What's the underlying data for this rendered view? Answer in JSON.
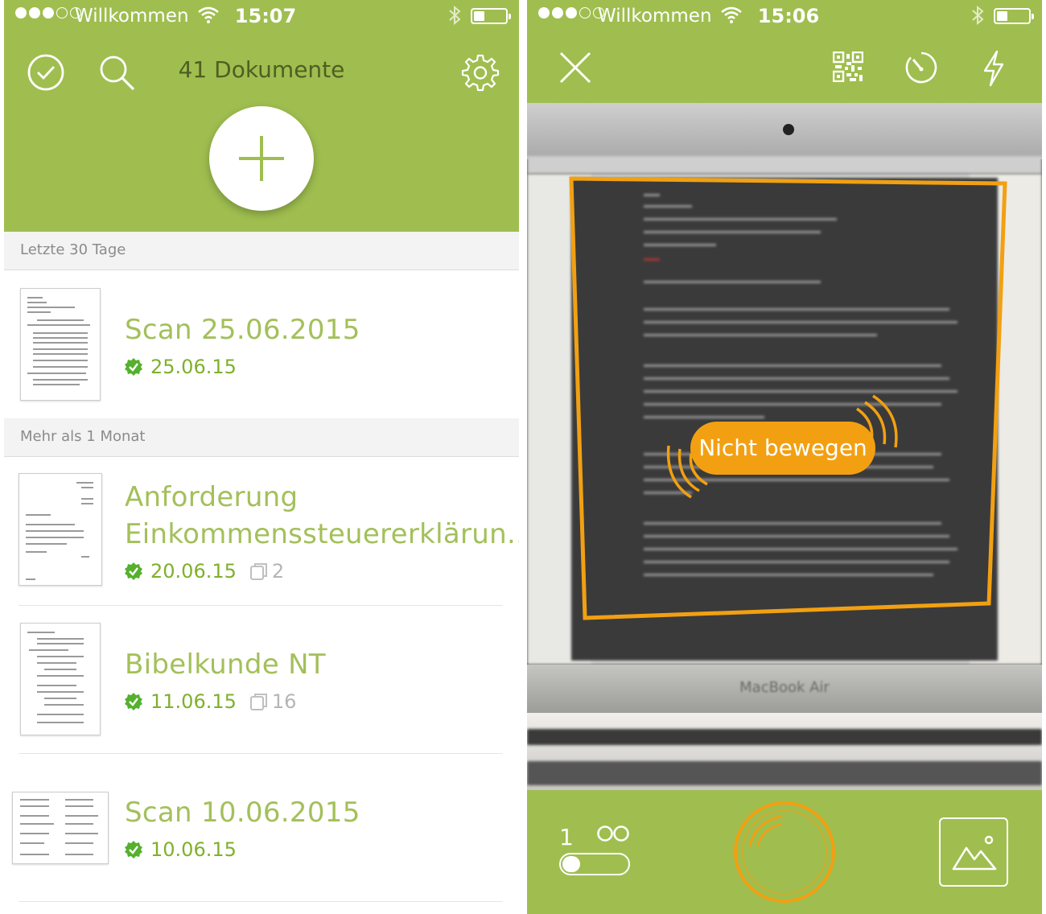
{
  "left": {
    "status": {
      "carrier": "Willkommen",
      "time": "15:07"
    },
    "header": {
      "title": "41 Dokumente"
    },
    "sections": [
      {
        "label": "Letzte 30 Tage"
      },
      {
        "label": "Mehr als 1 Monat"
      }
    ],
    "documents": [
      {
        "title": "Scan 25.06.2015",
        "date": "25.06.15",
        "pages": ""
      },
      {
        "title_line1": "Anforderung",
        "title_line2": "Einkommenssteuererklärun...",
        "date": "20.06.15",
        "pages": "2"
      },
      {
        "title": "Bibelkunde NT",
        "date": "11.06.15",
        "pages": "16"
      },
      {
        "title": "Scan 10.06.2015",
        "date": "10.06.15",
        "pages": ""
      }
    ],
    "icons": {
      "select": "check-circle-icon",
      "search": "search-icon",
      "settings": "gear-icon",
      "add": "plus-icon",
      "synced": "green-check-badge-icon",
      "pages": "pages-stack-icon"
    }
  },
  "right": {
    "status": {
      "carrier": "Willkommen",
      "time": "15:06"
    },
    "hint": "Nicht bewegen",
    "laptop_brand": "MacBook Air",
    "counter": {
      "count": "1",
      "infinite": "∞"
    },
    "icons": {
      "close": "close-icon",
      "qr": "qr-code-icon",
      "timer": "timer-icon",
      "flash": "flash-icon",
      "shutter": "shutter-button-icon",
      "gallery": "gallery-icon"
    }
  },
  "colors": {
    "brand_green": "#9fbe4f",
    "title_green": "#a3c05a",
    "date_green": "#7fb02c",
    "accent_orange": "#f2a012"
  }
}
